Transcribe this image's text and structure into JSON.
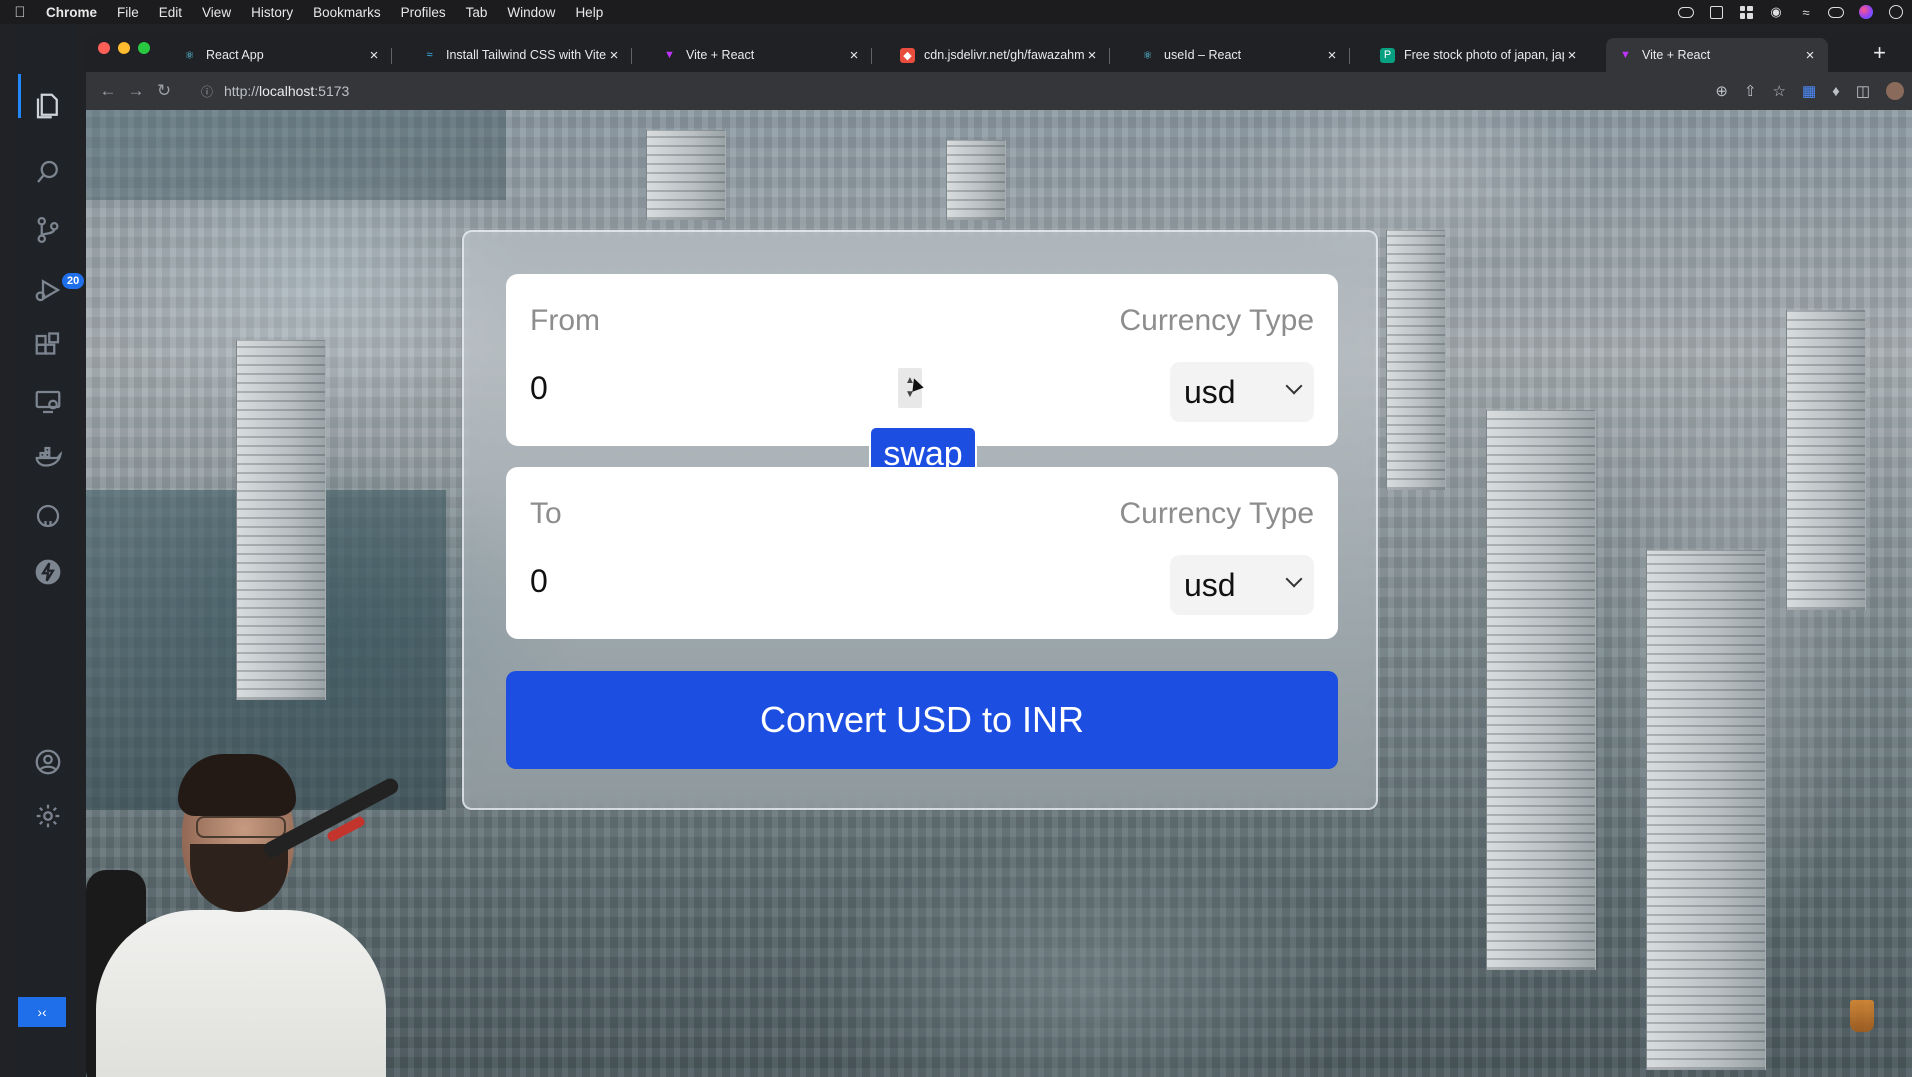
{
  "menubar": {
    "app": "Chrome",
    "items": [
      "File",
      "Edit",
      "View",
      "History",
      "Bookmarks",
      "Profiles",
      "Tab",
      "Window",
      "Help"
    ]
  },
  "vscode": {
    "scm_badge": "20"
  },
  "browser": {
    "tabs": [
      {
        "title": "React App",
        "icon": "react-icon",
        "color": "#61dafb"
      },
      {
        "title": "Install Tailwind CSS with Vite -",
        "icon": "tailwind-icon",
        "color": "#38bdf8"
      },
      {
        "title": "Vite + React",
        "icon": "vite-icon",
        "color": "#bd34fe"
      },
      {
        "title": "cdn.jsdelivr.net/gh/fawazahme",
        "icon": "jsdelivr-icon",
        "color": "#e84d3d"
      },
      {
        "title": "useId – React",
        "icon": "react-icon",
        "color": "#61dafb"
      },
      {
        "title": "Free stock photo of japan, japa",
        "icon": "pexels-icon",
        "color": "#05a081"
      },
      {
        "title": "Vite + React",
        "icon": "vite-icon",
        "color": "#bd34fe"
      }
    ],
    "active_tab_index": 6,
    "url_prefix": "http://",
    "url_host": "localhost",
    "url_port": ":5173"
  },
  "app": {
    "from": {
      "label": "From",
      "currency_type_label": "Currency Type",
      "amount": "0",
      "currency": "usd"
    },
    "to": {
      "label": "To",
      "currency_type_label": "Currency Type",
      "amount": "0",
      "currency": "usd"
    },
    "swap_label": "swap",
    "convert_label": "Convert USD to INR",
    "accent_color": "#1d4ee2"
  }
}
